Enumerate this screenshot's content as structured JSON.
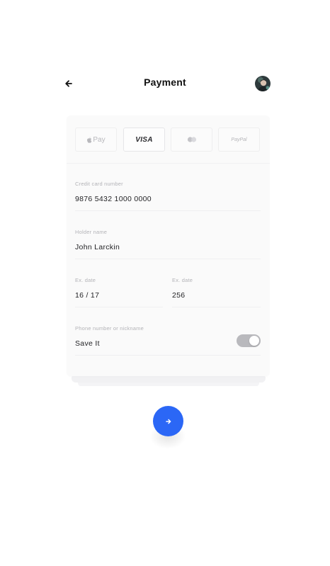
{
  "header": {
    "title": "Payment",
    "back_icon": "arrow-left-icon",
    "avatar_icon": "user-avatar"
  },
  "payment_methods": [
    {
      "label": "Pay",
      "icon": "apple-icon",
      "selected": false
    },
    {
      "label": "VISA",
      "icon": "visa-logo",
      "selected": true
    },
    {
      "label": "",
      "icon": "mastercard-icon",
      "selected": false
    },
    {
      "label": "PayPal",
      "icon": "paypal-logo",
      "selected": false
    }
  ],
  "form": {
    "card_number": {
      "label": "Credit card number",
      "value": "9876 5432 1000 0000"
    },
    "holder_name": {
      "label": "Holder name",
      "value": "John Larckin"
    },
    "exp_date": {
      "label": "Ex. date",
      "value": "16 / 17"
    },
    "cvv": {
      "label": "Ex. date",
      "value": "256"
    },
    "save": {
      "label": "Phone number or nickname",
      "value": "Save It",
      "toggle_on": true
    }
  },
  "next_button": {
    "icon": "arrow-right-icon"
  },
  "colors": {
    "accent": "#2b67f6",
    "toggle_track": "#b9b9bd",
    "card_bg": "#fafafa"
  }
}
